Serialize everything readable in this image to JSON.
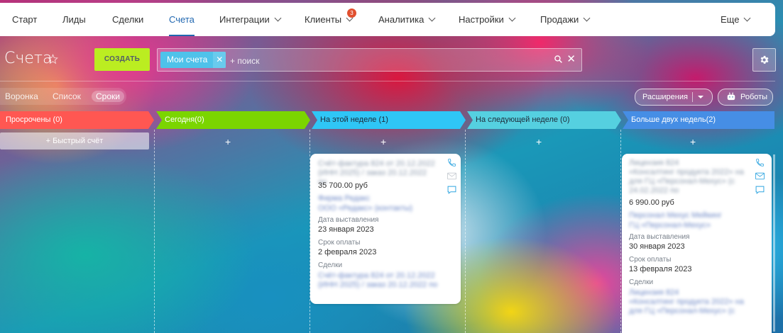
{
  "nav": {
    "items": [
      {
        "label": "Старт"
      },
      {
        "label": "Лиды"
      },
      {
        "label": "Сделки"
      },
      {
        "label": "Счета"
      },
      {
        "label": "Интеграции"
      },
      {
        "label": "Клиенты",
        "badge": "3"
      },
      {
        "label": "Аналитика"
      },
      {
        "label": "Настройки"
      },
      {
        "label": "Продажи"
      },
      {
        "label": "Еще"
      }
    ]
  },
  "page": {
    "title": "Счета",
    "create_label": "СОЗДАТЬ",
    "filter_tag": "Мои счета",
    "search_placeholder": "+ поиск"
  },
  "views": [
    "Воронка",
    "Список",
    "Сроки"
  ],
  "toolbar": {
    "extensions_label": "Расширения",
    "robots_label": "Роботы"
  },
  "stages": [
    {
      "name": "Просрочены",
      "count": "(0)",
      "color": "#ff5752"
    },
    {
      "name": "Сегодня",
      "count": "(0)",
      "color": "#7bd500"
    },
    {
      "name": "На этой неделе",
      "count": "(1)",
      "color": "#2fc6f6"
    },
    {
      "name": "На следующей неделе",
      "count": "(0)",
      "color": "#55d0e0"
    },
    {
      "name": "Больше двух недель",
      "count": "(2)",
      "color": "#468ee5"
    }
  ],
  "quick_add_label": "+  Быстрый счёт",
  "cards": [
    {
      "title": "Счёт-фактура 824 от 20.12.2022 (ИНН 2025) / заказ 20.12.2022 по",
      "amount": "35 700.00 руб",
      "client": "Фирма Редакс",
      "client2": "ООО «Редакс» (контакты)",
      "invoice_date_label": "Дата выставления",
      "invoice_date": "23 января 2023",
      "due_label": "Срок оплаты",
      "due_date": "2 февраля 2023",
      "deals_label": "Сделки",
      "deal": "Счёт-фактура 824 от 20.12.2022 (ИНН 2025) / заказ 20.12.2022 по"
    },
    {
      "title_l1": "Лицензия 824",
      "title_l2": "«Консалтинг продукта 2022» на",
      "title_l3": "для ГЦ «Персонал-Мехус» (с",
      "title_l4": "24.02.2022 по",
      "amount": "6 990.00 руб",
      "client": "Персонал Мехус Мейкинг",
      "client2": "ГЦ «Персонал-Мехус»",
      "invoice_date_label": "Дата выставления",
      "invoice_date": "30 января 2023",
      "due_label": "Срок оплаты",
      "due_date": "13 февраля 2023",
      "deals_label": "Сделки",
      "deal_l1": "Лицензия 824",
      "deal_l2": "«Консалтинг продукта 2022» на",
      "deal_l3": "для ГЦ «Персонал-Мехус» (с"
    }
  ]
}
